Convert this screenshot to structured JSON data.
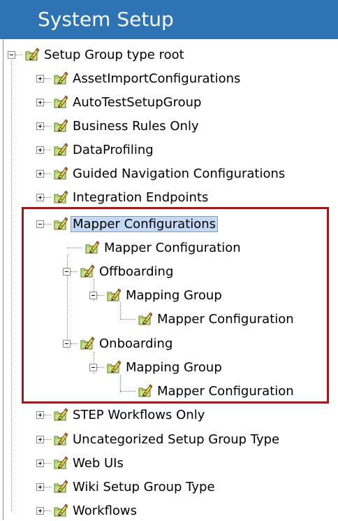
{
  "header": {
    "title": "System Setup"
  },
  "tree": {
    "root": "Setup Group type root",
    "groups": {
      "asset": "AssetImportConfigurations",
      "autotest": "AutoTestSetupGroup",
      "business": "Business Rules Only",
      "dataprofiling": "DataProfiling",
      "guided": "Guided Navigation Configurations",
      "integration": "Integration Endpoints",
      "mapper": "Mapper Configurations",
      "step": "STEP Workflows Only",
      "uncategorized": "Uncategorized Setup Group Type",
      "webuis": "Web UIs",
      "wiki": "Wiki Setup Group Type",
      "workflows": "Workflows"
    },
    "mapper_children": {
      "mapper_configuration": "Mapper Configuration",
      "offboarding": "Offboarding",
      "offboarding_mapping_group": "Mapping Group",
      "offboarding_mapper_configuration": "Mapper Configuration",
      "onboarding": "Onboarding",
      "onboarding_mapping_group": "Mapping Group",
      "onboarding_mapper_configuration": "Mapper Configuration"
    }
  },
  "colors": {
    "header_bg": "#2e74b5",
    "highlight_border": "#9b1b1f",
    "selection_bg": "#c3d9f5"
  },
  "icon_name": "setup-group-pencil-icon"
}
